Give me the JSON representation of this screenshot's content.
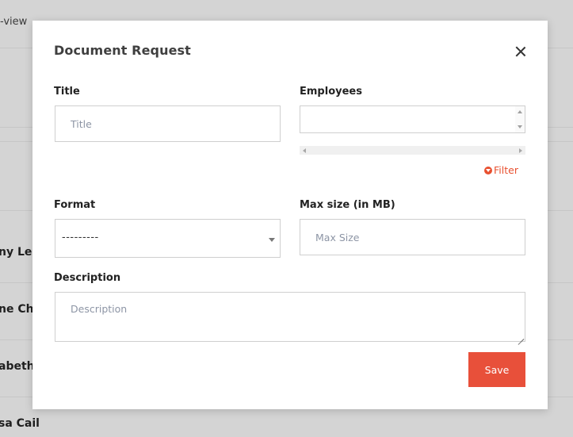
{
  "background": {
    "top_text": "-view",
    "names": [
      "ny Lee",
      "ne Ch",
      "abeth",
      "sa Cail"
    ]
  },
  "modal": {
    "title": "Document Request",
    "close_icon": "close-icon",
    "fields": {
      "title": {
        "label": "Title",
        "placeholder": "Title",
        "value": ""
      },
      "employees": {
        "label": "Employees",
        "value": ""
      },
      "filter_label": "Filter",
      "format": {
        "label": "Format",
        "selected": "---------"
      },
      "max_size": {
        "label": "Max size (in MB)",
        "placeholder": "Max Size",
        "value": ""
      },
      "description": {
        "label": "Description",
        "placeholder": "Description",
        "value": ""
      }
    },
    "save_label": "Save"
  },
  "colors": {
    "accent": "#e8503a",
    "filter": "#e8502f",
    "overlay": "#d4d4d4"
  }
}
